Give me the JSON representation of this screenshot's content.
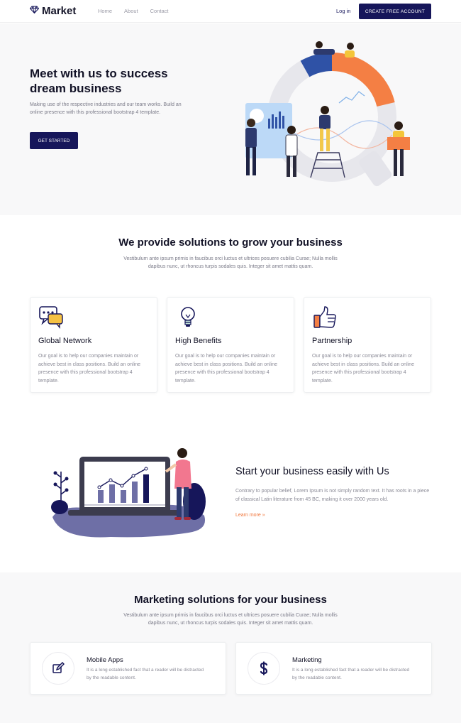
{
  "nav": {
    "brand": "Market",
    "links": [
      "Home",
      "About",
      "Contact"
    ],
    "login": "Log in",
    "cta": "CREATE FREE ACCOUNT"
  },
  "hero": {
    "title": "Meet with us to success dream business",
    "description": "Making use of the respective industries and our team works. Build an online presence with this professional bootstrap 4 template.",
    "button": "GET STARTED"
  },
  "solutions": {
    "title": "We provide solutions to grow your business",
    "description": "Vestibulum ante ipsum primis in faucibus orci luctus et ultrices posuere cubilia Curae; Nulla mollis dapibus nunc, ut rhoncus turpis sodales quis. Integer sit amet mattis quam.",
    "cards": [
      {
        "icon": "chat-icon",
        "title": "Global Network",
        "text": "Our goal is to help our companies maintain or achieve best in class positions. Build an online presence with this professional bootstrap 4 template."
      },
      {
        "icon": "lightbulb-icon",
        "title": "High Benefits",
        "text": "Our goal is to help our companies maintain or achieve best in class positions. Build an online presence with this professional bootstrap 4 template."
      },
      {
        "icon": "thumbs-up-icon",
        "title": "Partnership",
        "text": "Our goal is to help our companies maintain or achieve best in class positions. Build an online presence with this professional bootstrap 4 template."
      }
    ]
  },
  "business": {
    "title": "Start your business easily with Us",
    "text": "Contrary to popular belief, Lorem Ipsum is not simply random text. It has roots in a piece of classical Latin literature from 45 BC, making it over 2000 years old.",
    "link": "Learn more »"
  },
  "marketing": {
    "title": "Marketing solutions for your business",
    "description": "Vestibulum ante ipsum primis in faucibus orci luctus et ultrices posuere cubilia Curae; Nulla mollis dapibus nunc, ut rhoncus turpis sodales quis. Integer sit amet mattis quam.",
    "cards": [
      {
        "icon": "edit-icon",
        "title": "Mobile Apps",
        "text": "It is a long established fact that a reader will be distracted by the readable content."
      },
      {
        "icon": "dollar-icon",
        "title": "Marketing",
        "text": "It is a long established fact that a reader will be distracted by the readable content."
      }
    ]
  },
  "colors": {
    "primary": "#16165a",
    "accent": "#f0753a",
    "muted": "#8a8a96"
  }
}
